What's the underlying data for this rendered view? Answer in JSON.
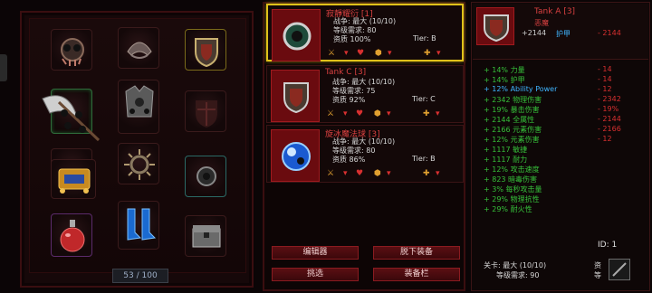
{
  "equipment": {
    "counter": "53 / 100",
    "slots": [
      {
        "name": "amulet",
        "frame": ""
      },
      {
        "name": "helmet",
        "frame": ""
      },
      {
        "name": "shield",
        "frame": "gold"
      },
      {
        "name": "weapon-scythe",
        "frame": "green"
      },
      {
        "name": "chest-armor",
        "frame": ""
      },
      {
        "name": "shield-silhouette",
        "frame": ""
      },
      {
        "name": "ring-left",
        "frame": ""
      },
      {
        "name": "spiked-ring",
        "frame": ""
      },
      {
        "name": "ring-right",
        "frame": "teal"
      },
      {
        "name": "gold-artifact",
        "frame": ""
      },
      {
        "name": "boots",
        "frame": ""
      },
      {
        "name": "chest",
        "frame": ""
      },
      {
        "name": "potion",
        "frame": "purple"
      }
    ]
  },
  "items": [
    {
      "title": "寂靜耀衍 [1]",
      "lines": [
        "战争: 最大 (10/10)",
        "等级需求: 80",
        "资质 100%"
      ],
      "tier": "Tier: B",
      "active": true
    },
    {
      "title": "Tank C [3]",
      "lines": [
        "战争: 最大 (10/10)",
        "等级需求: 75",
        "资质 92%"
      ],
      "tier": "Tier: C",
      "active": false
    },
    {
      "title": "旋冰魔法球 [3]",
      "lines": [
        "战争: 最大 (10/10)",
        "等级需求: 80",
        "资质 86%"
      ],
      "tier": "Tier: B",
      "active": false
    }
  ],
  "actions": {
    "b1": "编辑器",
    "b2": "脱下装备",
    "b3": "挑选",
    "b4": "装备栏"
  },
  "detail": {
    "name": "Tank A [3]",
    "subtitle": "恶魔",
    "armor_plus": "+2144",
    "armor_label": "护甲",
    "armor_minus": "- 2144",
    "stats": [
      {
        "l": "+ 14%  力量",
        "r": "- 14",
        "c": "green"
      },
      {
        "l": "+ 14%  护甲",
        "r": "- 14",
        "c": "green"
      },
      {
        "l": "+ 12%  Ability Power",
        "r": "- 12",
        "c": "blue"
      },
      {
        "l": "+ 2342  物理伤害",
        "r": "- 2342",
        "c": "green"
      },
      {
        "l": "+ 19%  暴击伤害",
        "r": "- 19%",
        "c": "green"
      },
      {
        "l": "+ 2144  全属性",
        "r": "- 2144",
        "c": "green"
      },
      {
        "l": "+ 2166  元素伤害",
        "r": "- 2166",
        "c": "green"
      },
      {
        "l": "+ 12%  元素伤害",
        "r": "- 12",
        "c": "green"
      },
      {
        "l": "+ 1117  敏捷",
        "r": "",
        "c": "green"
      },
      {
        "l": "+ 1117  耐力",
        "r": "",
        "c": "green"
      },
      {
        "l": "+ 12%  攻击速度",
        "r": "",
        "c": "green"
      },
      {
        "l": "+ 823  暗毒伤害",
        "r": "",
        "c": "green"
      },
      {
        "l": "+ 3%  每秒攻击量",
        "r": "",
        "c": "green"
      },
      {
        "l": "+ 29%  物理抗性",
        "r": "",
        "c": "green"
      },
      {
        "l": "+ 29%  耐火性",
        "r": "",
        "c": "green"
      }
    ],
    "id": "ID: 1",
    "footer_level": "关卡: 最大 (10/10)",
    "footer_req": "等级需求: 90",
    "footer_r1": "资",
    "footer_r2": "等"
  }
}
